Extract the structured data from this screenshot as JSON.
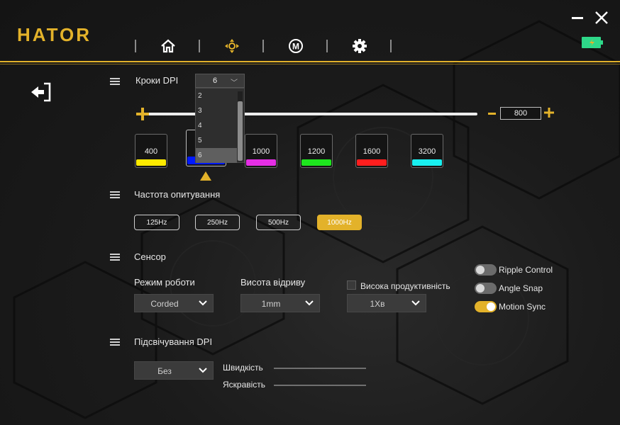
{
  "header": {
    "logo": "HATOR",
    "nav": [
      {
        "icon": "home-icon"
      },
      {
        "icon": "dpi-target-icon"
      },
      {
        "icon": "macro-icon"
      },
      {
        "icon": "gear-icon"
      }
    ],
    "macro_letter": "M",
    "battery_color": "#2ed889"
  },
  "dpi": {
    "title": "Кроки DPI",
    "steps_selected": "6",
    "steps_options": [
      "2",
      "3",
      "4",
      "5",
      "6"
    ],
    "current_value": "800",
    "presets": [
      {
        "value": "400",
        "color": "#ffeb00"
      },
      {
        "value": "800",
        "color": "#0019ff"
      },
      {
        "value": "1000",
        "color": "#e52ee5"
      },
      {
        "value": "1200",
        "color": "#1ee61e"
      },
      {
        "value": "1600",
        "color": "#ff1e1e"
      },
      {
        "value": "3200",
        "color": "#19f0f0"
      }
    ],
    "active_index": 1
  },
  "polling": {
    "title": "Частота опитування",
    "rates": [
      "125Hz",
      "250Hz",
      "500Hz",
      "1000Hz"
    ],
    "active": "1000Hz"
  },
  "sensor": {
    "title": "Сенсор",
    "mode_label": "Режим роботи",
    "mode_value": "Corded",
    "lod_label": "Висота відриву",
    "lod_value": "1mm",
    "perf_label": "Висока продуктивність",
    "perf_value": "1Хв",
    "toggles": [
      {
        "label": "Ripple Control",
        "on": false
      },
      {
        "label": "Angle Snap",
        "on": false
      },
      {
        "label": "Motion Sync",
        "on": true
      }
    ]
  },
  "backlight": {
    "title": "Підсвічування DPI",
    "mode_value": "Без",
    "speed_label": "Швидкість",
    "brightness_label": "Яскравість"
  },
  "colors": {
    "accent": "#e3b22a"
  }
}
